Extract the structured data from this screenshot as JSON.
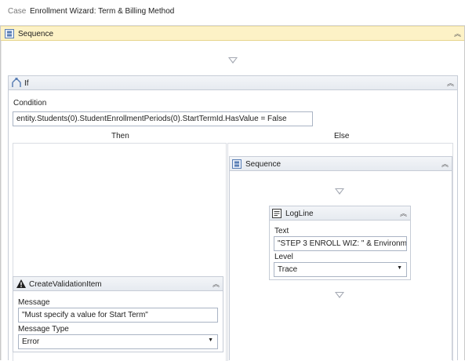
{
  "breadcrumb": {
    "case_label": "Case",
    "title": "Enrollment Wizard: Term & Billing Method"
  },
  "outer_sequence": {
    "label": "Sequence",
    "collapse": "˄˄"
  },
  "if_activity": {
    "label": "If",
    "condition_label": "Condition",
    "condition_value": "entity.Students(0).StudentEnrollmentPeriods(0).StartTermId.HasValue = False",
    "then_label": "Then",
    "else_label": "Else"
  },
  "validation_item": {
    "label": "CreateValidationItem",
    "message_label": "Message",
    "message_value": "\"Must specify a value for Start Term\"",
    "message_type_label": "Message Type",
    "message_type_value": "Error"
  },
  "inner_sequence": {
    "label": "Sequence"
  },
  "logline": {
    "label": "LogLine",
    "text_label": "Text",
    "text_value": "\"STEP 3 ENROLL WIZ: \" & Environme",
    "level_label": "Level",
    "level_value": "Trace"
  },
  "icons": {
    "sequence": "sequence-icon",
    "if": "if-icon",
    "warning": "warning-icon",
    "logline": "logline-icon",
    "collapse": "collapse-icon",
    "dropdown": "chevron-down-icon",
    "drop_target": "drop-target-icon"
  },
  "colors": {
    "sequence_header": "#fdf2c6",
    "activity_border": "#c6ccd6",
    "drop_arrow": "#a4a9b3"
  }
}
